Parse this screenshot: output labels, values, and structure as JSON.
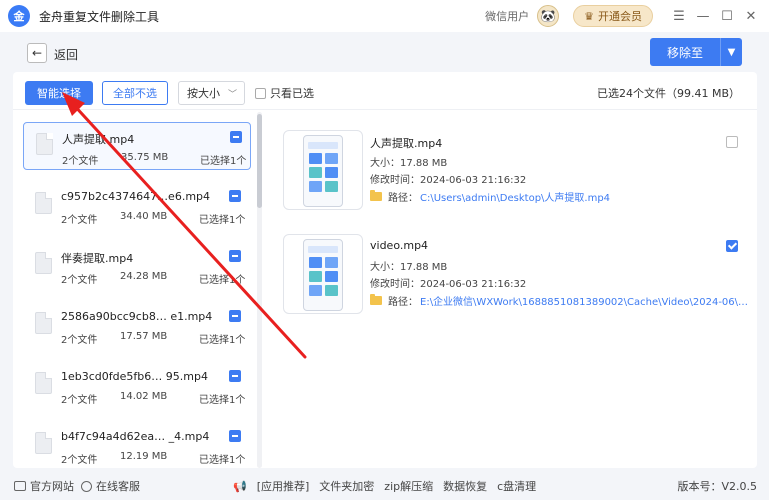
{
  "app": {
    "title": "金舟重复文件删除工具",
    "logo_text": "金",
    "user_name": "微信用户",
    "vip_label": "开通会员"
  },
  "window_controls": [
    "☰",
    "—",
    "☐",
    "✕"
  ],
  "actions": {
    "back_label": "返回",
    "move_to_label": "移除至"
  },
  "toolbar": {
    "smart_select_label": "智能选择",
    "deselect_all_label": "全部不选",
    "sort_value": "按大小",
    "only_selected_label": "只看已选",
    "summary": "已选24个文件（99.41 MB）"
  },
  "groups": [
    {
      "name": "人声提取.mp4",
      "count": "2个文件",
      "size": "35.75 MB",
      "selected": "已选择1个",
      "active": true
    },
    {
      "name": "c957b2c4374647…e6.mp4",
      "count": "2个文件",
      "size": "34.40 MB",
      "selected": "已选择1个",
      "active": false
    },
    {
      "name": "伴奏提取.mp4",
      "count": "2个文件",
      "size": "24.28 MB",
      "selected": "已选择1个",
      "active": false
    },
    {
      "name": "2586a90bcc9cb8… e1.mp4",
      "count": "2个文件",
      "size": "17.57 MB",
      "selected": "已选择1个",
      "active": false
    },
    {
      "name": "1eb3cd0fde5fb6… 95.mp4",
      "count": "2个文件",
      "size": "14.02 MB",
      "selected": "已选择1个",
      "active": false
    },
    {
      "name": "b4f7c94a4d62ea… _4.mp4",
      "count": "2个文件",
      "size": "12.19 MB",
      "selected": "已选择1个",
      "active": false
    }
  ],
  "details": [
    {
      "name": "人声提取.mp4",
      "size": "大小：17.88 MB",
      "mtime": "修改时间：2024-06-03 21:16:32",
      "path_label": "路径：",
      "path": "C:\\Users\\admin\\Desktop\\人声提取.mp4",
      "checked": false
    },
    {
      "name": "video.mp4",
      "size": "大小：17.88 MB",
      "mtime": "修改时间：2024-06-03 21:16:32",
      "path_label": "路径：",
      "path": "E:\\企业微信\\WXWork\\1688851081389002\\Cache\\Video\\2024-06\\vide...",
      "checked": true
    }
  ],
  "footer": {
    "website": "官方网站",
    "support": "在线客服",
    "links": [
      "[应用推荐]",
      "文件夹加密",
      "zip解压缩",
      "数据恢复",
      "c盘清理"
    ],
    "version": "版本号：V2.0.5"
  },
  "colors": {
    "accent": "#3d7bf2",
    "annotation_arrow": "#e8201f"
  }
}
